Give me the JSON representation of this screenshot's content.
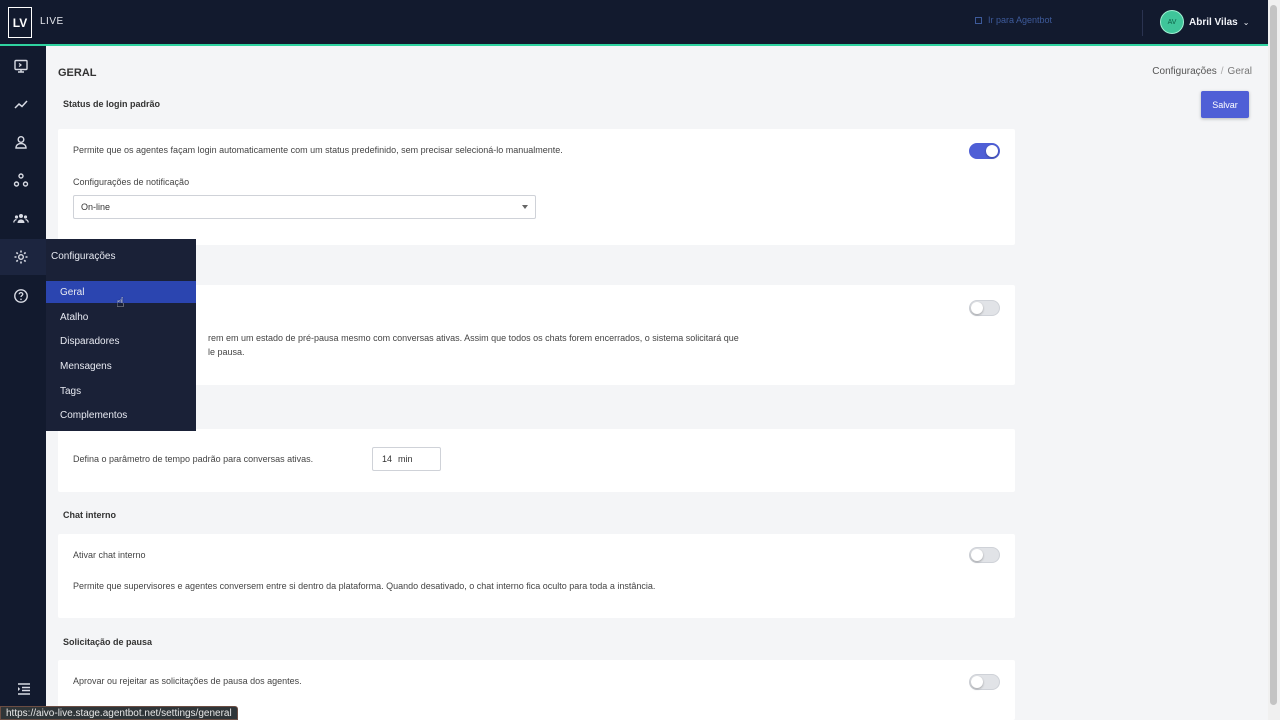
{
  "topbar": {
    "logo_text": "LV",
    "brand_word": "LIVE",
    "go_agentbot": "Ir para Agentbot",
    "user_initials": "AV",
    "user_name": "Abril Vilas",
    "accent_color": "#2fd3a0"
  },
  "sidebar": {
    "icons": [
      "monitor-icon",
      "chart-line-icon",
      "user-icon",
      "network-icon",
      "team-icon",
      "gear-icon",
      "help-icon",
      "collapse-menu-icon"
    ]
  },
  "flyout": {
    "title": "Configurações",
    "items": [
      "Geral",
      "Atalho",
      "Disparadores",
      "Mensagens",
      "Tags",
      "Complementos"
    ],
    "active": "Geral"
  },
  "page": {
    "title": "GERAL",
    "breadcrumb_parent": "Configurações",
    "breadcrumb_sep": "/",
    "breadcrumb_current": "Geral",
    "save_label": "Salvar"
  },
  "sections": {
    "login_status": {
      "title": "Status de login padrão",
      "description": "Permite que os agentes façam login automaticamente com um status predefinido, sem precisar selecioná-lo manualmente.",
      "toggle_on": true,
      "select_label": "Configurações de notificação",
      "select_value": "On-line"
    },
    "pre_pause": {
      "line1": "rem em um estado de pré-pausa mesmo com conversas ativas. Assim que todos os chats forem encerrados, o sistema solicitará que",
      "line2": "le pausa.",
      "toggle_on": false
    },
    "active_time": {
      "description": "Defina o parâmetro de tempo padrão para conversas ativas.",
      "value": "14",
      "unit": "min"
    },
    "internal_chat": {
      "title": "Chat interno",
      "label": "Ativar chat interno",
      "description": "Permite que supervisores e agentes conversem entre si dentro da plataforma. Quando desativado, o chat interno fica oculto para toda a instância.",
      "toggle_on": false
    },
    "pause_request": {
      "title": "Solicitação de pausa",
      "description": "Aprovar ou rejeitar as solicitações de pausa dos agentes.",
      "toggle_on": false
    }
  },
  "status_url": "https://aivo-live.stage.agentbot.net/settings/general"
}
